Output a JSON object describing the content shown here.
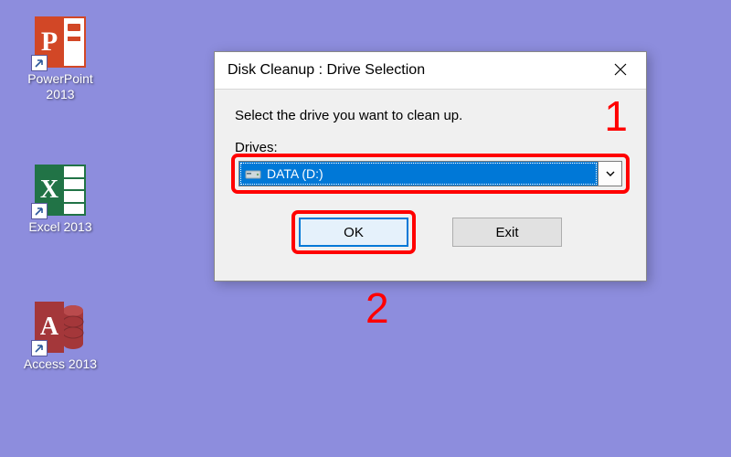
{
  "desktop": {
    "icons": [
      {
        "name": "powerpoint-2013",
        "label": "PowerPoint\n2013",
        "letter": "P"
      },
      {
        "name": "excel-2013",
        "label": "Excel 2013",
        "letter": "X"
      },
      {
        "name": "access-2013",
        "label": "Access 2013",
        "letter": "A"
      }
    ]
  },
  "dialog": {
    "title": "Disk Cleanup : Drive Selection",
    "instruction": "Select the drive you want to clean up.",
    "drives_label": "Drives:",
    "selected_drive": "DATA (D:)",
    "ok_label": "OK",
    "exit_label": "Exit"
  },
  "annotations": {
    "num1": "1",
    "num2": "2"
  }
}
